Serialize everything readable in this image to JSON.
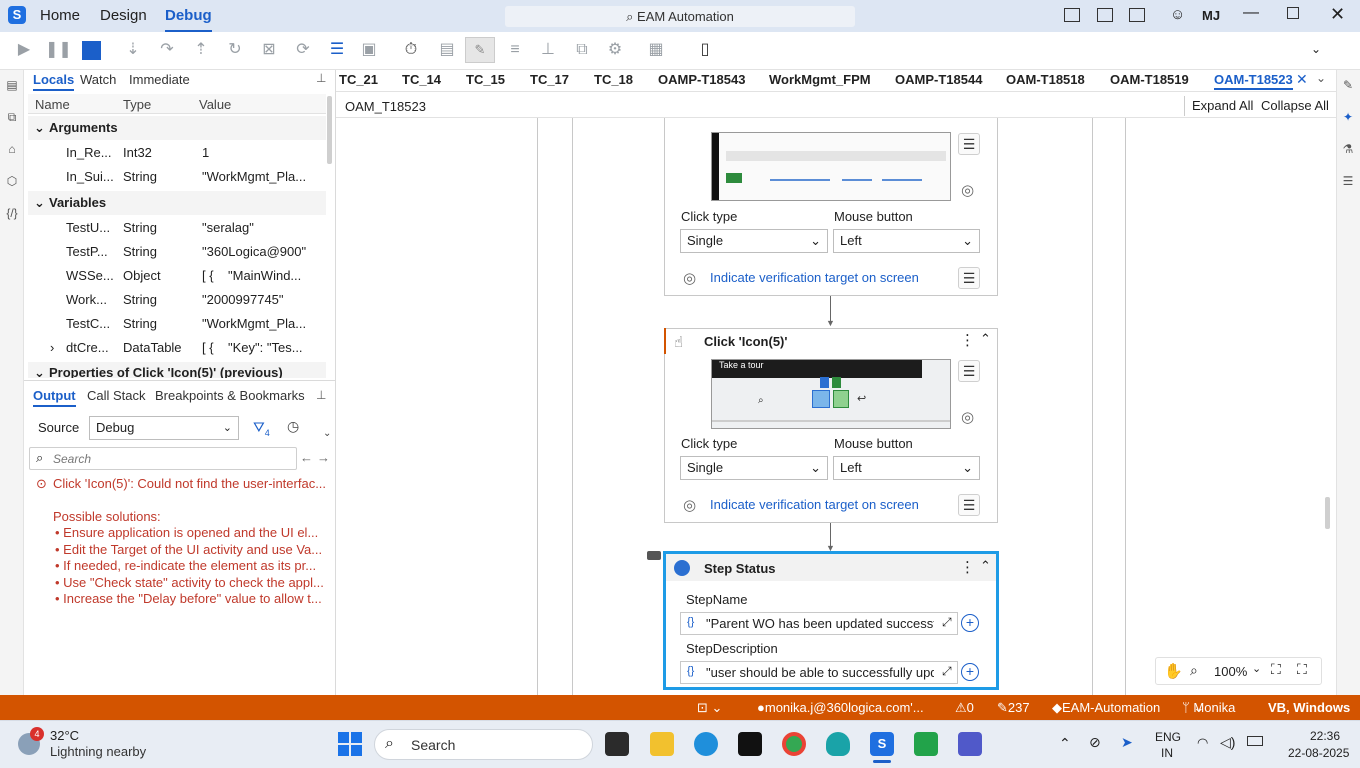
{
  "window": {
    "menus": [
      "Home",
      "Design",
      "Debug"
    ],
    "search": "EAM Automation",
    "user_initials": "MJ"
  },
  "locals_panel": {
    "tabs": [
      "Locals",
      "Watch",
      "Immediate"
    ],
    "columns": [
      "Name",
      "Type",
      "Value"
    ],
    "arguments_label": "Arguments",
    "arguments": [
      {
        "name": "In_Re...",
        "type": "Int32",
        "value": "1"
      },
      {
        "name": "In_Sui...",
        "type": "String",
        "value": "\"WorkMgmt_Pla..."
      }
    ],
    "variables_label": "Variables",
    "variables": [
      {
        "name": "TestU...",
        "type": "String",
        "value": "\"seralag\""
      },
      {
        "name": "TestP...",
        "type": "String",
        "value": "\"360Logica@900\""
      },
      {
        "name": "WSSe...",
        "type": "Object",
        "value": "[ {    \"MainWind..."
      },
      {
        "name": "Work...",
        "type": "String",
        "value": "\"2000997745\""
      },
      {
        "name": "TestC...",
        "type": "String",
        "value": "\"WorkMgmt_Pla..."
      },
      {
        "name": "dtCre...",
        "type": "DataTable",
        "value": "[ {    \"Key\": \"Tes..."
      }
    ],
    "properties_label": "Properties of Click 'Icon(5)' (previous)"
  },
  "output_panel": {
    "tabs": [
      "Output",
      "Call Stack",
      "Breakpoints & Bookmarks"
    ],
    "source_label": "Source",
    "source_value": "Debug",
    "filter_count": "4",
    "search_placeholder": "Search",
    "error": "Click 'Icon(5)': Could not find the user-interfac...",
    "solutions_title": "Possible solutions:",
    "solutions": [
      "Ensure application is opened and the UI el...",
      "Edit the Target of the UI activity and use Va...",
      "If needed, re-indicate the element as its pr...",
      "Use \"Check state\" activity to check the appl...",
      "Increase the \"Delay before\" value to allow t..."
    ]
  },
  "doc_tabs": [
    "TC_21",
    "TC_14",
    "TC_15",
    "TC_17",
    "TC_18",
    "OAMP-T18543",
    "WorkMgmt_FPM",
    "OAMP-T18544",
    "OAM-T18518",
    "OAM-T18519",
    "OAM-T18523"
  ],
  "designer": {
    "breadcrumb": "OAM_T18523",
    "expand_all": "Expand All",
    "collapse_all": "Collapse All",
    "click_type_label": "Click type",
    "mouse_button_label": "Mouse button",
    "click_type_value": "Single",
    "mouse_button_value": "Left",
    "verify_link": "Indicate verification target on screen",
    "activity2_title": "Click 'Icon(5)'",
    "thumb2_text": "Take a tour",
    "step_status": {
      "title": "Step Status",
      "name_label": "StepName",
      "name_value": "\"Parent WO has been updated successfu",
      "desc_label": "StepDescription",
      "desc_value": "\"user should be able to successfully upda"
    },
    "zoom": "100%"
  },
  "status_bar": {
    "email": "monika.j@360logica.com'...",
    "errors": "0",
    "edits": "237",
    "project": "EAM-Automation",
    "user": "Monika",
    "platform": "VB, Windows"
  },
  "taskbar": {
    "weather_badge": "4",
    "temperature": "32°C",
    "weather_text": "Lightning nearby",
    "search": "Search",
    "lang": "ENG",
    "region": "IN",
    "time": "22:36",
    "date": "22-08-2025"
  },
  "colors": {
    "accent": "#1b5fc9",
    "status_bar": "#d35400",
    "error": "#c0392b",
    "selected_border": "#1e9be6"
  }
}
